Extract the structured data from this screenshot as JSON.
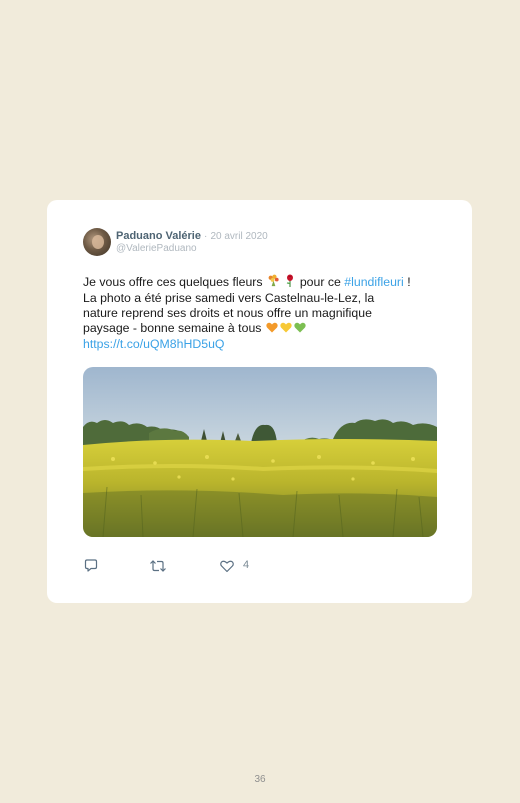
{
  "tweet": {
    "author_name": "Paduano Valérie",
    "separator": "·",
    "date": "20 avril 2020",
    "handle": "@ValeriePaduano",
    "text_line1_a": "Je vous offre ces quelques fleurs",
    "text_line1_b": "pour ce",
    "hashtag": "#lundifleuri",
    "text_line1_c": "!",
    "text_line2": "La photo a été prise samedi vers Castelnau-le-Lez, la",
    "text_line3": "nature reprend ses droits et nous offre un magnifique",
    "text_line4": "paysage - bonne semaine à tous",
    "link": "https://t.co/uQM8hHD5uQ",
    "like_count": "4"
  },
  "colors": {
    "page_background": "#f1ebdb",
    "author_name": "#4e6473",
    "link": "#3ba2e6",
    "muted": "#b0b8bf"
  },
  "icons": [
    "avatar",
    "bouquet-emoji",
    "rose-emoji",
    "orange-heart-emoji",
    "yellow-heart-emoji",
    "green-heart-emoji",
    "reply-icon",
    "retweet-icon",
    "like-icon"
  ],
  "page": {
    "number": "36"
  }
}
